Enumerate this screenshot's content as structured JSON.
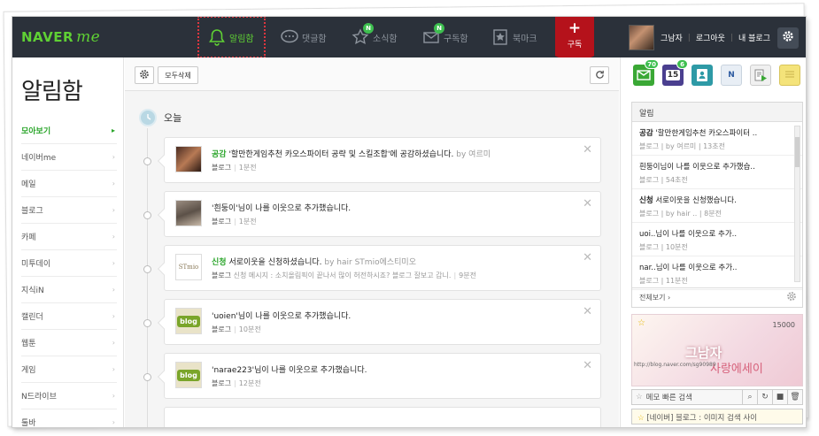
{
  "nav": {
    "logo_text": "NAVER",
    "logo_me": "me",
    "items": [
      {
        "label": "알림함",
        "icon": "bell-icon",
        "active": true
      },
      {
        "label": "댓글함",
        "icon": "comment-icon"
      },
      {
        "label": "소식함",
        "icon": "news-icon",
        "badge": "N"
      },
      {
        "label": "구독함",
        "icon": "subscribe-mail-icon",
        "badge": "N"
      },
      {
        "label": "북마크",
        "icon": "bookmark-icon"
      }
    ],
    "subscribe_plus": "+",
    "subscribe_label": "구독",
    "user_name": "그남자",
    "logout": "로그아웃",
    "my_blog": "내 블로그"
  },
  "sidebar": {
    "title": "알림함",
    "items": [
      {
        "label": "모아보기",
        "selected": true
      },
      {
        "label": "네이버me"
      },
      {
        "label": "메일"
      },
      {
        "label": "블로그"
      },
      {
        "label": "카페"
      },
      {
        "label": "미투데이"
      },
      {
        "label": "지식iN"
      },
      {
        "label": "캘린더"
      },
      {
        "label": "웹툰"
      },
      {
        "label": "게임"
      },
      {
        "label": "N드라이브"
      },
      {
        "label": "툴바"
      }
    ]
  },
  "toolbar": {
    "delete_all": "모두삭제"
  },
  "feed": {
    "today_label": "오늘",
    "cards": [
      {
        "keyword": "공감",
        "text": "'할만한게임추천 카오스파이터 공략 및 스킬조합'에 공감하셨습니다.",
        "by": "by 여르미",
        "service": "블로그",
        "extra": "",
        "time": "1분전",
        "thumb": "photo"
      },
      {
        "keyword": "",
        "text": "'흰둥이'님이 나를 이웃으로 추가했습니다.",
        "by": "",
        "service": "블로그",
        "extra": "",
        "time": "1분전",
        "thumb": "photo2"
      },
      {
        "keyword": "신청",
        "text": "서로이웃을 신청하셨습니다.",
        "by": "by hair STmio에스티미오",
        "service": "블로그",
        "extra": "신청 메시지 : 소치올림픽이 끝나서 많이 허전하시죠? 블로그 잘보고 갑니.",
        "time": "9분전",
        "thumb": "stmio"
      },
      {
        "keyword": "",
        "text": "'uoien'님이 나를 이웃으로 추가했습니다.",
        "by": "",
        "service": "블로그",
        "extra": "",
        "time": "10분전",
        "thumb": "blog"
      },
      {
        "keyword": "",
        "text": "'narae223'님이 나를 이웃으로 추가했습니다.",
        "by": "",
        "service": "블로그",
        "extra": "",
        "time": "12분전",
        "thumb": "blog"
      }
    ],
    "blog_badge": "blog",
    "stmio_text": "STmio"
  },
  "right": {
    "apps": [
      {
        "icon": "mail-app-icon",
        "count": "70",
        "color": "#3aa835"
      },
      {
        "icon": "calendar-app-icon",
        "count": "6",
        "label": "15",
        "color": "#4a3f8f"
      },
      {
        "icon": "contacts-app-icon",
        "count": "",
        "color": "#2e9aa6"
      },
      {
        "icon": "naver-n-app-icon",
        "count": "",
        "label": "N",
        "color": "#e8eef5"
      },
      {
        "icon": "media-app-icon",
        "count": "",
        "color": "#f0f0f0"
      },
      {
        "icon": "memo-app-icon",
        "count": "",
        "color": "#f4e37a"
      }
    ],
    "panel_title": "알림",
    "notifications": [
      {
        "bold": "공감",
        "text": " '할만한게임추천 카오스파이터 ..",
        "meta": "블로그 | by 여르미 | 13초전"
      },
      {
        "bold": "",
        "text": "흰둥이님이 나를 이웃으로 추가했습..",
        "meta": "블로그 | 54초전"
      },
      {
        "bold": "신청",
        "text": " 서로이웃을 신청했습니다.",
        "meta": "블로그 | by hair .. | 8분전"
      },
      {
        "bold": "",
        "text": "uoi..님이 나를 이웃으로 추가..",
        "meta": "블로그 | 10분전"
      },
      {
        "bold": "",
        "text": "nar..님이 나를 이웃으로 추가..",
        "meta": "블로그 | 11분전"
      }
    ],
    "view_all": "전체보기 ›",
    "memo_count": "15000",
    "memo_title": "그남자",
    "memo_subtitle": "사랑에세이",
    "memo_url": "http://blog.naver.com/sg90989",
    "memo_search_placeholder": "메모 빠른 검색",
    "bottom_text": "[네이버] 블로그 : 이미지 검색 사이"
  }
}
